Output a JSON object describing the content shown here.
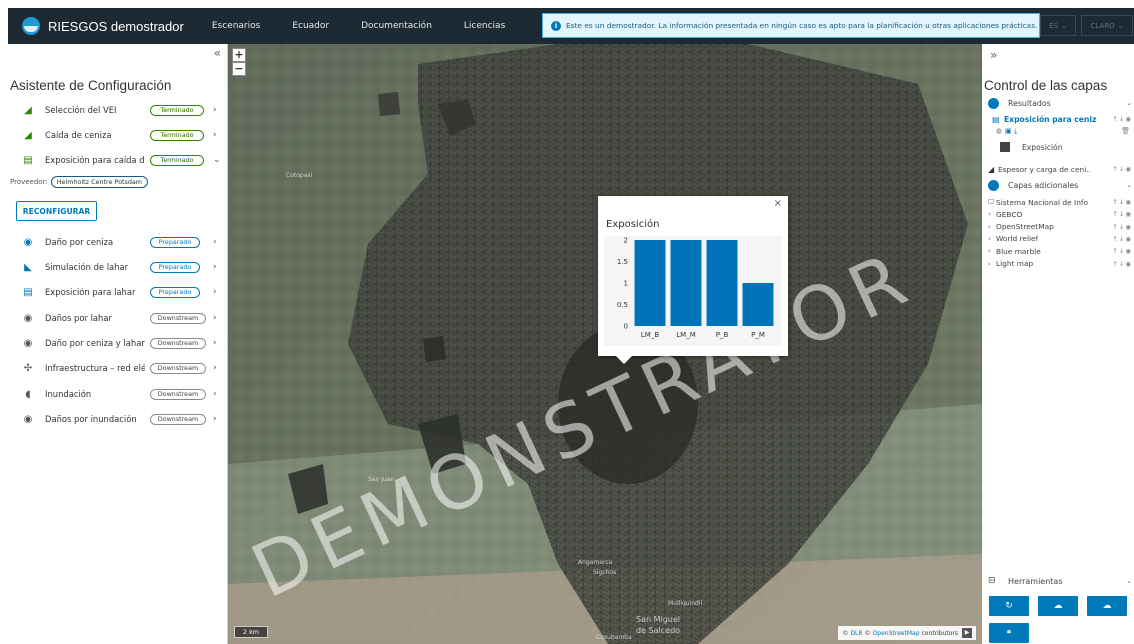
{
  "header": {
    "brand": "RIESGOS demostrador",
    "nav": [
      "Escenarios",
      "Ecuador",
      "Documentación",
      "Licencias"
    ],
    "alert_text": "Este es un demostrador. La información presentada en ningún caso es apto para la planificación u otras aplicaciones prácticas.",
    "lang_button": "ES",
    "theme_button": "CLARO"
  },
  "left_panel": {
    "title": "Asistente de Configuración",
    "collapse_icon": "double-chevron-left-icon",
    "steps": [
      {
        "label": "Selección del VEI",
        "status": "Terminado",
        "state": "done",
        "icon": "volcano-icon",
        "chev": "›"
      },
      {
        "label": "Caída de ceniza",
        "status": "Terminado",
        "state": "done",
        "icon": "volcano-icon",
        "chev": "›"
      },
      {
        "label": "Exposición para caída de",
        "status": "Terminado",
        "state": "done",
        "icon": "building-icon",
        "chev": "⌄"
      },
      {
        "label": "Daño por ceniza",
        "status": "Preparado",
        "state": "ready",
        "icon": "target-icon",
        "chev": "›"
      },
      {
        "label": "Simulación de lahar",
        "status": "Preparado",
        "state": "ready",
        "icon": "lahar-icon",
        "chev": "›"
      },
      {
        "label": "Exposición para lahar",
        "status": "Preparado",
        "state": "ready",
        "icon": "building-icon",
        "chev": "›"
      },
      {
        "label": "Daños por lahar",
        "status": "Downstream",
        "state": "down",
        "icon": "target-icon",
        "chev": "›"
      },
      {
        "label": "Daño por ceniza y lahar",
        "status": "Downstream",
        "state": "down",
        "icon": "target-icon",
        "chev": "›"
      },
      {
        "label": "Infraestructura – red eléc",
        "status": "Downstream",
        "state": "down",
        "icon": "network-icon",
        "chev": "›"
      },
      {
        "label": "Inundación",
        "status": "Downstream",
        "state": "down",
        "icon": "wave-icon",
        "chev": "›"
      },
      {
        "label": "Daños por inundación",
        "status": "Downstream",
        "state": "down",
        "icon": "target-icon",
        "chev": "›"
      }
    ],
    "provider_label": "Proveedor:",
    "provider_name": "Helmholtz Centre Potsdam",
    "reconfigure_label": "RECONFIGURAR"
  },
  "map": {
    "watermark": "DEMONSTRATOR",
    "scale": "2 km",
    "attribution_prefix": "©",
    "attribution_dlr": "DLR",
    "attribution_osm": "OpenStreetMap",
    "attribution_suffix": "contributors",
    "places": [
      {
        "name": "Cotopaxi",
        "cls": "p1"
      },
      {
        "name": "San Juan",
        "cls": "p2"
      },
      {
        "name": "Angamarca",
        "cls": "p3"
      },
      {
        "name": "Sigchos",
        "cls": "p4"
      },
      {
        "name": "Mulliquindil",
        "cls": "p5"
      },
      {
        "name": "San Miguel",
        "cls": "p6"
      },
      {
        "name": "de Salcedo",
        "cls": "p7"
      },
      {
        "name": "Cusubamba",
        "cls": "p8"
      }
    ],
    "popup": {
      "title": "Exposición",
      "close": "×"
    }
  },
  "chart_data": {
    "type": "bar",
    "categories": [
      "LM_B",
      "LM_M",
      "P_B",
      "P_M"
    ],
    "values": [
      2,
      2,
      2,
      1
    ],
    "title": "Exposición",
    "ylim": [
      0,
      2
    ],
    "yticks": [
      0,
      0.5,
      1,
      1.5,
      2
    ],
    "bar_color": "#0072b8"
  },
  "right_panel": {
    "title": "Control de las capas",
    "collapse_icon": "double-chevron-right-icon",
    "results_label": "Resultados",
    "active_layer": "Exposición para ceniza",
    "legend_label": "Exposición",
    "layer_espesor": "Espesor y carga de ceni...",
    "additional_label": "Capas adicionales",
    "extra_layers": [
      "Sistema Nacional de Info...",
      "GEBCO",
      "OpenStreetMap",
      "World relief",
      "Blue marble",
      "Light map"
    ],
    "tools_label": "Herramientas"
  },
  "colors": {
    "header_bg": "#1d2a33",
    "accent": "#0079b8",
    "done": "#318700"
  }
}
